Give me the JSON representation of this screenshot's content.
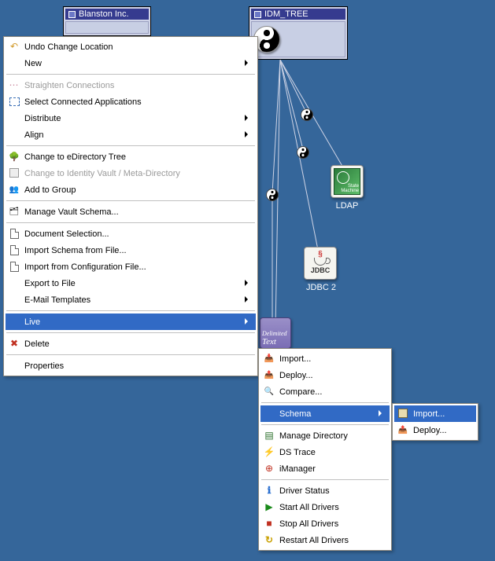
{
  "nodes": {
    "blanston": {
      "title": "Blanston Inc."
    },
    "idm": {
      "title": "IDM_TREE"
    }
  },
  "labels": {
    "ldap": "LDAP",
    "jdbc": "JDBC 2"
  },
  "text_node": {
    "line1": "Delimited",
    "line2": "Text"
  },
  "menu1": {
    "undo": "Undo Change Location",
    "new": "New",
    "straighten": "Straighten Connections",
    "select_connected": "Select Connected Applications",
    "distribute": "Distribute",
    "align": "Align",
    "change_tree": "Change to eDirectory Tree",
    "change_vault": "Change to Identity Vault / Meta-Directory",
    "add_group": "Add to Group",
    "manage_vault": "Manage Vault Schema...",
    "doc_selection": "Document Selection...",
    "import_schema": "Import Schema from File...",
    "import_config": "Import from Configuration File...",
    "export_file": "Export to File",
    "email_templates": "E-Mail Templates",
    "live": "Live",
    "delete": "Delete",
    "properties": "Properties"
  },
  "menu2": {
    "import": "Import...",
    "deploy": "Deploy...",
    "compare": "Compare...",
    "schema": "Schema",
    "manage_dir": "Manage Directory",
    "ds_trace": "DS Trace",
    "imanager": "iManager",
    "driver_status": "Driver Status",
    "start_all": "Start All Drivers",
    "stop_all": "Stop All Drivers",
    "restart_all": "Restart All Drivers"
  },
  "menu3": {
    "import": "Import...",
    "deploy": "Deploy..."
  }
}
